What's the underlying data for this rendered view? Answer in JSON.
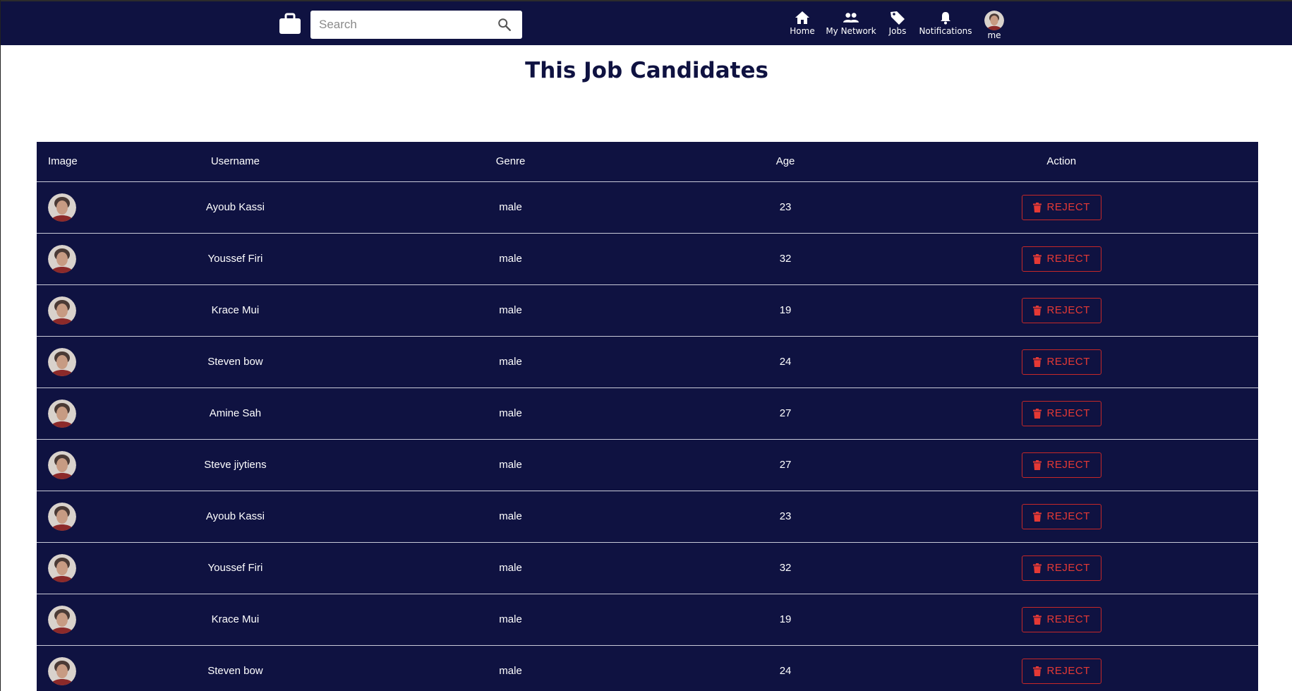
{
  "navbar": {
    "brand_icon": "briefcase-icon",
    "search": {
      "placeholder": "Search",
      "value": ""
    },
    "items": [
      {
        "label": "Home",
        "icon": "home-icon"
      },
      {
        "label": "My Network",
        "icon": "people-icon"
      },
      {
        "label": "Jobs",
        "icon": "tag-icon"
      },
      {
        "label": "Notifications",
        "icon": "bell-icon"
      },
      {
        "label": "me",
        "icon": "avatar"
      }
    ]
  },
  "page": {
    "title": "This Job Candidates"
  },
  "table": {
    "headers": {
      "image": "Image",
      "username": "Username",
      "genre": "Genre",
      "age": "Age",
      "action": "Action"
    },
    "reject_label": "REJECT",
    "rows": [
      {
        "username": "Ayoub Kassi",
        "genre": "male",
        "age": "23"
      },
      {
        "username": "Youssef Firi",
        "genre": "male",
        "age": "32"
      },
      {
        "username": "Krace Mui",
        "genre": "male",
        "age": "19"
      },
      {
        "username": "Steven bow",
        "genre": "male",
        "age": "24"
      },
      {
        "username": "Amine Sah",
        "genre": "male",
        "age": "27"
      },
      {
        "username": "Steve jiytiens",
        "genre": "male",
        "age": "27"
      },
      {
        "username": "Ayoub Kassi",
        "genre": "male",
        "age": "23"
      },
      {
        "username": "Youssef Firi",
        "genre": "male",
        "age": "32"
      },
      {
        "username": "Krace Mui",
        "genre": "male",
        "age": "19"
      },
      {
        "username": "Steven bow",
        "genre": "male",
        "age": "24"
      }
    ]
  },
  "colors": {
    "navy": "#0f1241",
    "reject_red": "#e53935",
    "divider": "#c9cad8"
  }
}
